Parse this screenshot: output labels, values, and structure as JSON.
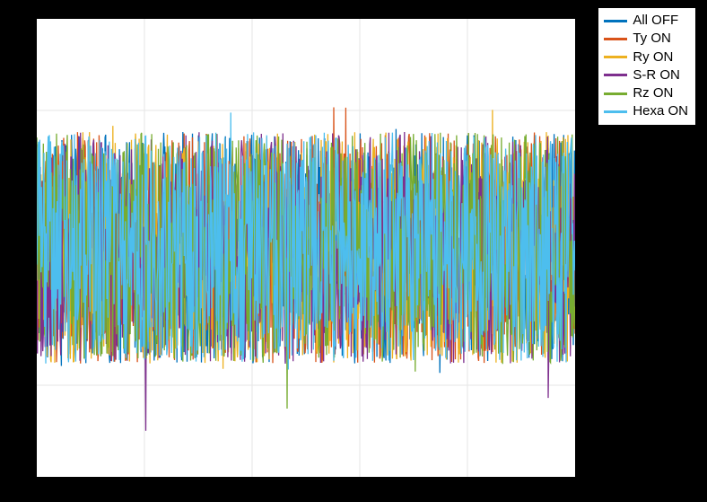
{
  "chart_data": {
    "type": "line",
    "title": "",
    "xlabel": "",
    "ylabel": "",
    "xlim": [
      0,
      1
    ],
    "ylim": [
      -1,
      1
    ],
    "grid": true,
    "legend_position": "outside-right-top",
    "series": [
      {
        "name": "All OFF",
        "color": "#0072BD",
        "description": "dense noise signal, amplitude roughly ±0.6 with occasional spikes to ~±0.8"
      },
      {
        "name": "Ty ON",
        "color": "#D95319",
        "description": "dense noise signal, amplitude roughly ±0.6 with occasional spikes to ~±0.8"
      },
      {
        "name": "Ry ON",
        "color": "#EDB120",
        "description": "dense noise signal, amplitude roughly ±0.6 with occasional spikes to ~±0.8"
      },
      {
        "name": "S-R ON",
        "color": "#7E2F8E",
        "description": "dense noise signal, amplitude roughly ±0.6 with occasional spikes to ~±0.8"
      },
      {
        "name": "Rz ON",
        "color": "#77AC30",
        "description": "dense noise signal, amplitude roughly ±0.6 with occasional spikes to ~±0.8"
      },
      {
        "name": "Hexa ON",
        "color": "#4DBEEE",
        "description": "dense noise signal, amplitude roughly ±0.6 with occasional spikes to ~±0.8, drawn last so appears on top"
      }
    ],
    "note": "Individual sample values are not readable from the screenshot; series appear as overlapping broadband noise of similar amplitude. Rendering uses synthetic noise of matching amplitude for visual recreation only."
  },
  "legend": {
    "items": [
      {
        "label": "All OFF",
        "color": "#0072BD"
      },
      {
        "label": "Ty ON",
        "color": "#D95319"
      },
      {
        "label": "Ry ON",
        "color": "#EDB120"
      },
      {
        "label": "S-R ON",
        "color": "#7E2F8E"
      },
      {
        "label": "Rz ON",
        "color": "#77AC30"
      },
      {
        "label": "Hexa ON",
        "color": "#4DBEEE"
      }
    ]
  }
}
